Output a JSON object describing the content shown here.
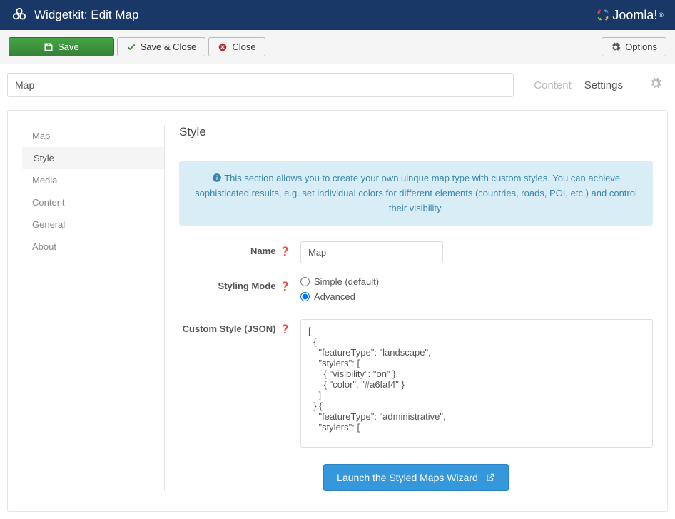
{
  "header": {
    "title": "Widgetkit: Edit Map",
    "brand": "Joomla!"
  },
  "toolbar": {
    "save": "Save",
    "save_close": "Save & Close",
    "close": "Close",
    "options": "Options"
  },
  "title_input": "Map",
  "subtabs": {
    "content": "Content",
    "settings": "Settings"
  },
  "sidebar": {
    "items": [
      "Map",
      "Style",
      "Media",
      "Content",
      "General",
      "About"
    ],
    "active_index": 1
  },
  "section": {
    "heading": "Style",
    "info": "This section allows you to create your own uinque map type with custom styles. You can achieve sophisticated results, e.g. set individual colors for different elements (countries, roads, POI, etc.) and control their visibility.",
    "name_label": "Name",
    "name_value": "Map",
    "styling_mode_label": "Styling Mode",
    "styling_mode_options": {
      "simple": "Simple (default)",
      "advanced": "Advanced"
    },
    "styling_mode_selected": "advanced",
    "custom_style_label": "Custom Style (JSON)",
    "custom_style_value": "[\n  {\n    \"featureType\": \"landscape\",\n    \"stylers\": [\n      { \"visibility\": \"on\" },\n      { \"color\": \"#a6faf4\" }\n    ]\n  },{\n    \"featureType\": \"administrative\",\n    \"stylers\": [",
    "wizard_button": "Launch the Styled Maps Wizard"
  }
}
